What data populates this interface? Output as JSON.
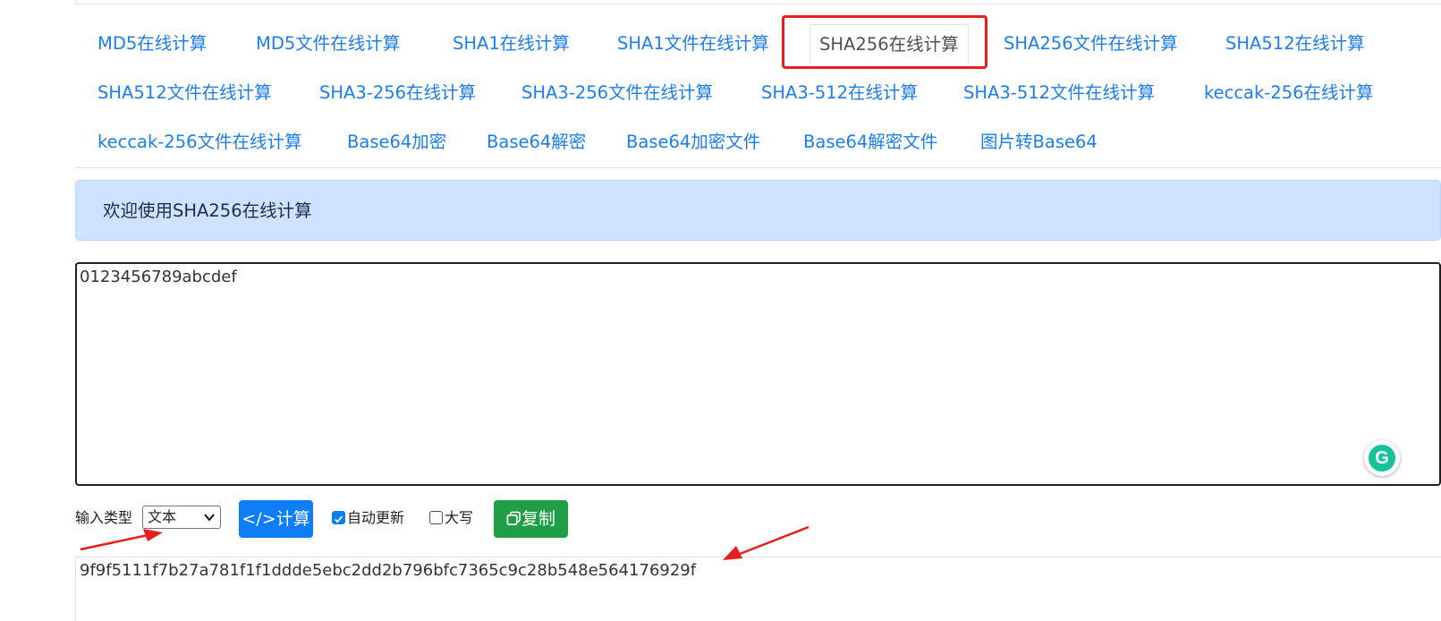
{
  "nav": {
    "items": [
      {
        "label": "MD5在线计算"
      },
      {
        "label": "MD5文件在线计算"
      },
      {
        "label": "SHA1在线计算"
      },
      {
        "label": "SHA1文件在线计算"
      },
      {
        "label": "SHA256在线计算",
        "active": true
      },
      {
        "label": "SHA256文件在线计算"
      },
      {
        "label": "SHA512在线计算"
      },
      {
        "label": "SHA512文件在线计算"
      },
      {
        "label": "SHA3-256在线计算"
      },
      {
        "label": "SHA3-256文件在线计算"
      },
      {
        "label": "SHA3-512在线计算"
      },
      {
        "label": "SHA3-512文件在线计算"
      },
      {
        "label": "keccak-256在线计算"
      },
      {
        "label": "keccak-256文件在线计算"
      },
      {
        "label": "Base64加密"
      },
      {
        "label": "Base64解密"
      },
      {
        "label": "Base64加密文件"
      },
      {
        "label": "Base64解密文件"
      },
      {
        "label": "图片转Base64"
      }
    ]
  },
  "alert": {
    "text": "欢迎使用SHA256在线计算"
  },
  "input": {
    "value": "0123456789abcdef"
  },
  "controls": {
    "input_type_label": "输入类型",
    "input_type_value": "文本",
    "calc_button": "</>计算",
    "auto_update_label": "自动更新",
    "auto_update_checked": true,
    "uppercase_label": "大写",
    "uppercase_checked": false,
    "copy_button": "复制"
  },
  "result": {
    "value": "9f9f5111f7b27a781f1f1ddde5ebc2dd2b796bfc7365c9c28b548e564176929f"
  },
  "grammarly": {
    "letter": "G"
  },
  "colors": {
    "link": "#1a7df4",
    "highlight": "#ea1d1d",
    "alert_bg": "#cfe2ff",
    "primary_button": "#0d7df8",
    "success_button": "#1f9e45",
    "annotation_arrow": "#ea1d1d"
  }
}
